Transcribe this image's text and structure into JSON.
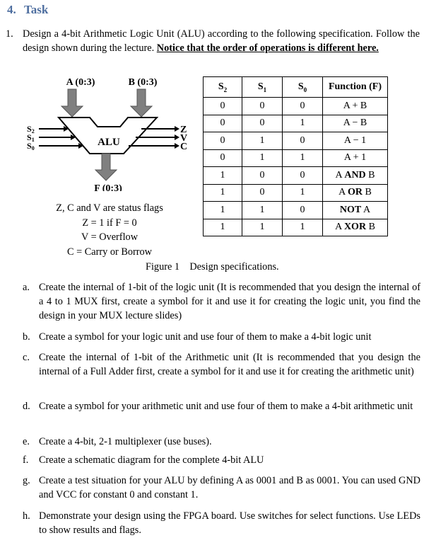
{
  "heading": {
    "number": "4.",
    "title": "Task"
  },
  "task1": {
    "number": "1.",
    "text": "Design a 4-bit Arithmetic Logic Unit (ALU) according to the following specification. Follow the design shown during the lecture. ",
    "emphasis": "Notice that the order of operations is different here."
  },
  "diagram": {
    "input_a": "A (0:3)",
    "input_b": "B (0:3)",
    "block": "ALU",
    "output_f": "F (0:3)",
    "selects": [
      "S2",
      "S1",
      "S0"
    ],
    "flags": [
      "Z",
      "V",
      "C"
    ],
    "notes": [
      "Z, C and V are status flags",
      "Z = 1 if F = 0",
      "V = Overflow",
      "C = Carry or Borrow"
    ],
    "arrow_color": "#808080"
  },
  "table": {
    "headers": [
      "S2",
      "S1",
      "S0",
      "Function (F)"
    ],
    "rows": [
      [
        "0",
        "0",
        "0",
        "A + B"
      ],
      [
        "0",
        "0",
        "1",
        "A − B"
      ],
      [
        "0",
        "1",
        "0",
        "A − 1"
      ],
      [
        "0",
        "1",
        "1",
        "A + 1"
      ],
      [
        "1",
        "0",
        "0",
        "A AND B"
      ],
      [
        "1",
        "0",
        "1",
        "A OR B"
      ],
      [
        "1",
        "1",
        "0",
        "NOT A"
      ],
      [
        "1",
        "1",
        "1",
        "A XOR B"
      ]
    ]
  },
  "figure_caption": {
    "label": "Figure 1",
    "text": "Design specifications."
  },
  "subtasks": [
    {
      "letter": "a.",
      "text": "Create the internal of 1-bit of the logic unit (It is recommended that you design the internal of a 4 to 1 MUX first, create a symbol for it and use it for creating the logic unit, you find the design in your MUX lecture slides)"
    },
    {
      "letter": "b.",
      "text": "Create a symbol for your logic unit and use four of them to make a 4-bit logic unit"
    },
    {
      "letter": "c.",
      "text": "Create the internal of 1-bit of the Arithmetic unit (It is recommended that you design the internal of a Full Adder first, create a symbol for it and use it for creating the arithmetic unit)"
    },
    {
      "letter": "d.",
      "text": "Create a symbol for your arithmetic unit and use four of them to make a 4-bit arithmetic unit"
    },
    {
      "letter": "e.",
      "text": "Create a 4-bit, 2-1 multiplexer (use buses)."
    },
    {
      "letter": "f.",
      "text": "Create a schematic diagram for the complete 4-bit ALU"
    },
    {
      "letter": "g.",
      "text": "Create a test situation for your ALU by defining A as 0001 and B as 0001. You can used GND and VCC for constant 0 and constant 1."
    },
    {
      "letter": "h.",
      "text": "Demonstrate your design using the FPGA board. Use switches for select functions. Use LEDs to show results and flags."
    }
  ]
}
